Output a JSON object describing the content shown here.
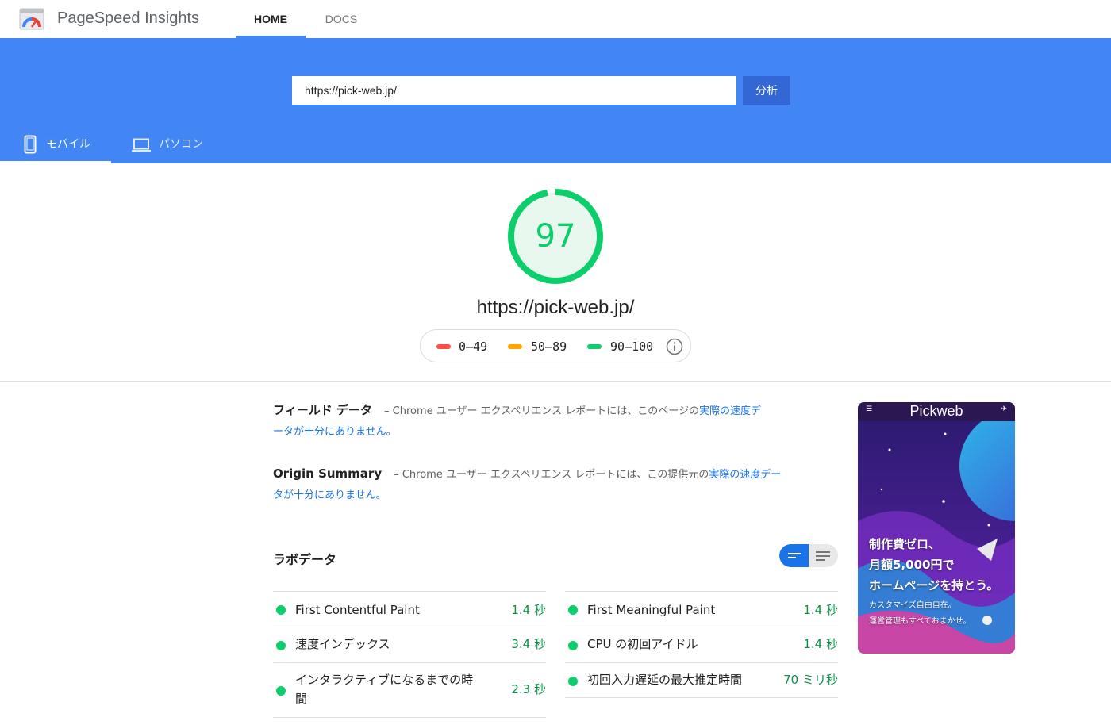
{
  "header": {
    "app_title": "PageSpeed Insights",
    "nav": {
      "home": "HOME",
      "docs": "DOCS"
    }
  },
  "search": {
    "url_value": "https://pick-web.jp/",
    "analyze_label": "分析"
  },
  "device_tabs": {
    "mobile": "モバイル",
    "desktop": "パソコン",
    "selected": "mobile"
  },
  "score": {
    "value": "97",
    "fraction": 0.97,
    "url": "https://pick-web.jp/",
    "legend": [
      {
        "range": "0–49",
        "color": "#ff4e42"
      },
      {
        "range": "50–89",
        "color": "#ffa400"
      },
      {
        "range": "90–100",
        "color": "#0cce6b"
      }
    ]
  },
  "field_data": {
    "title": "フィールド データ",
    "desc_line1": "– Chrome ユーザー エクスペリエンス レポートには、このページの",
    "link_part1": "実際の速度デ",
    "link_part2": "ータが十分にありません。"
  },
  "origin_summary": {
    "title": "Origin Summary",
    "desc_line1": "– Chrome ユーザー エクスペリエンス レポートには、この提供元の",
    "link_part1": "実際の速度デー",
    "link_part2": "タが十分にありません。"
  },
  "lab_data": {
    "title": "ラボデータ",
    "left": [
      {
        "name": "First Contentful Paint",
        "value": "1.4 秒"
      },
      {
        "name": "速度インデックス",
        "value": "3.4 秒"
      },
      {
        "name_line1": "インタラクティブになるまでの時",
        "name_line2": "間",
        "value": "2.3 秒"
      }
    ],
    "right": [
      {
        "name": "First Meaningful Paint",
        "value": "1.4 秒"
      },
      {
        "name": "CPU の初回アイドル",
        "value": "1.4 秒"
      },
      {
        "name": "初回入力遅延の最大推定時間",
        "value": "70 ミリ秒"
      }
    ]
  },
  "screenshot": {
    "logo": "Pickweb",
    "menu_label": "メニュー",
    "contact_label": "お問い合わせ",
    "headline1": "制作費ゼロ、",
    "headline2": "月額5,000円で",
    "headline3": "ホームページを持とう。",
    "sub1": "カスタマイズ自由自在。",
    "sub2": "運営管理もすべておまかせ。"
  },
  "colors": {
    "accent": "#4285f4",
    "pass": "#0cce6b",
    "average": "#ffa400",
    "fail": "#ff4e42"
  }
}
